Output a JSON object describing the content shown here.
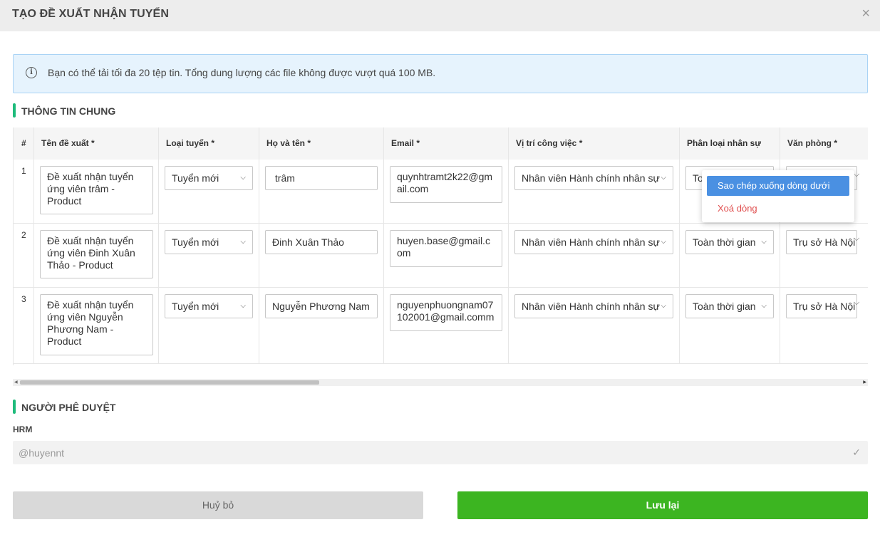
{
  "dialog": {
    "title": "TẠO ĐỀ XUẤT NHẬN TUYỂN",
    "close_icon": "×"
  },
  "info": {
    "icon": "i",
    "text": "Bạn có thể tải tối đa 20 tệp tin. Tổng dung lượng các file không được vượt quá 100 MB."
  },
  "section_general": "THÔNG TIN CHUNG",
  "table": {
    "headers": [
      "#",
      "Tên đề xuất *",
      "Loại tuyển *",
      "Họ và tên *",
      "Email *",
      "Vị trí công việc *",
      "Phân loại nhân sự",
      "Văn phòng *"
    ],
    "rows": [
      {
        "num": "1",
        "proposal": "Đề xuất nhận tuyển ứng viên  trâm  - Product",
        "type": "Tuyển mới",
        "name": " trâm",
        "email": "quynhtramt2k22@gmail.com",
        "position": "Nhân viên Hành chính nhân sự",
        "classification": "To",
        "office": ""
      },
      {
        "num": "2",
        "proposal": "Đề xuất nhận tuyển ứng viên Đinh Xuân Thảo  - Product",
        "type": "Tuyển mới",
        "name": "Đinh Xuân Thảo",
        "email": "huyen.base@gmail.com",
        "position": "Nhân viên Hành chính nhân sự",
        "classification": "Toàn thời gian",
        "office": "Trụ sở Hà Nội"
      },
      {
        "num": "3",
        "proposal": "Đề xuất nhận tuyển ứng viên Nguyễn Phương Nam  - Product",
        "type": "Tuyển mới",
        "name": "Nguyễn Phương Nam",
        "email": "nguyenphuongnam07102001@gmail.comm",
        "position": "Nhân viên Hành chính nhân sự",
        "classification": "Toàn thời gian",
        "office": "Trụ sở Hà Nội"
      }
    ]
  },
  "context_menu": {
    "copy_down": "Sao chép xuống dòng dưới",
    "delete_row": "Xoá dòng"
  },
  "section_approver": "NGƯỜI PHÊ DUYỆT",
  "approver": {
    "label": "HRM",
    "value": "@huyennt",
    "check_icon": "✓"
  },
  "buttons": {
    "cancel": "Huỷ bỏ",
    "save": "Lưu lại"
  },
  "colors": {
    "accent_green": "#1dbb7b",
    "save_green": "#3cb521",
    "menu_highlight": "#4a90e2",
    "danger": "#e05050",
    "info_bg": "#e6f3fd"
  }
}
